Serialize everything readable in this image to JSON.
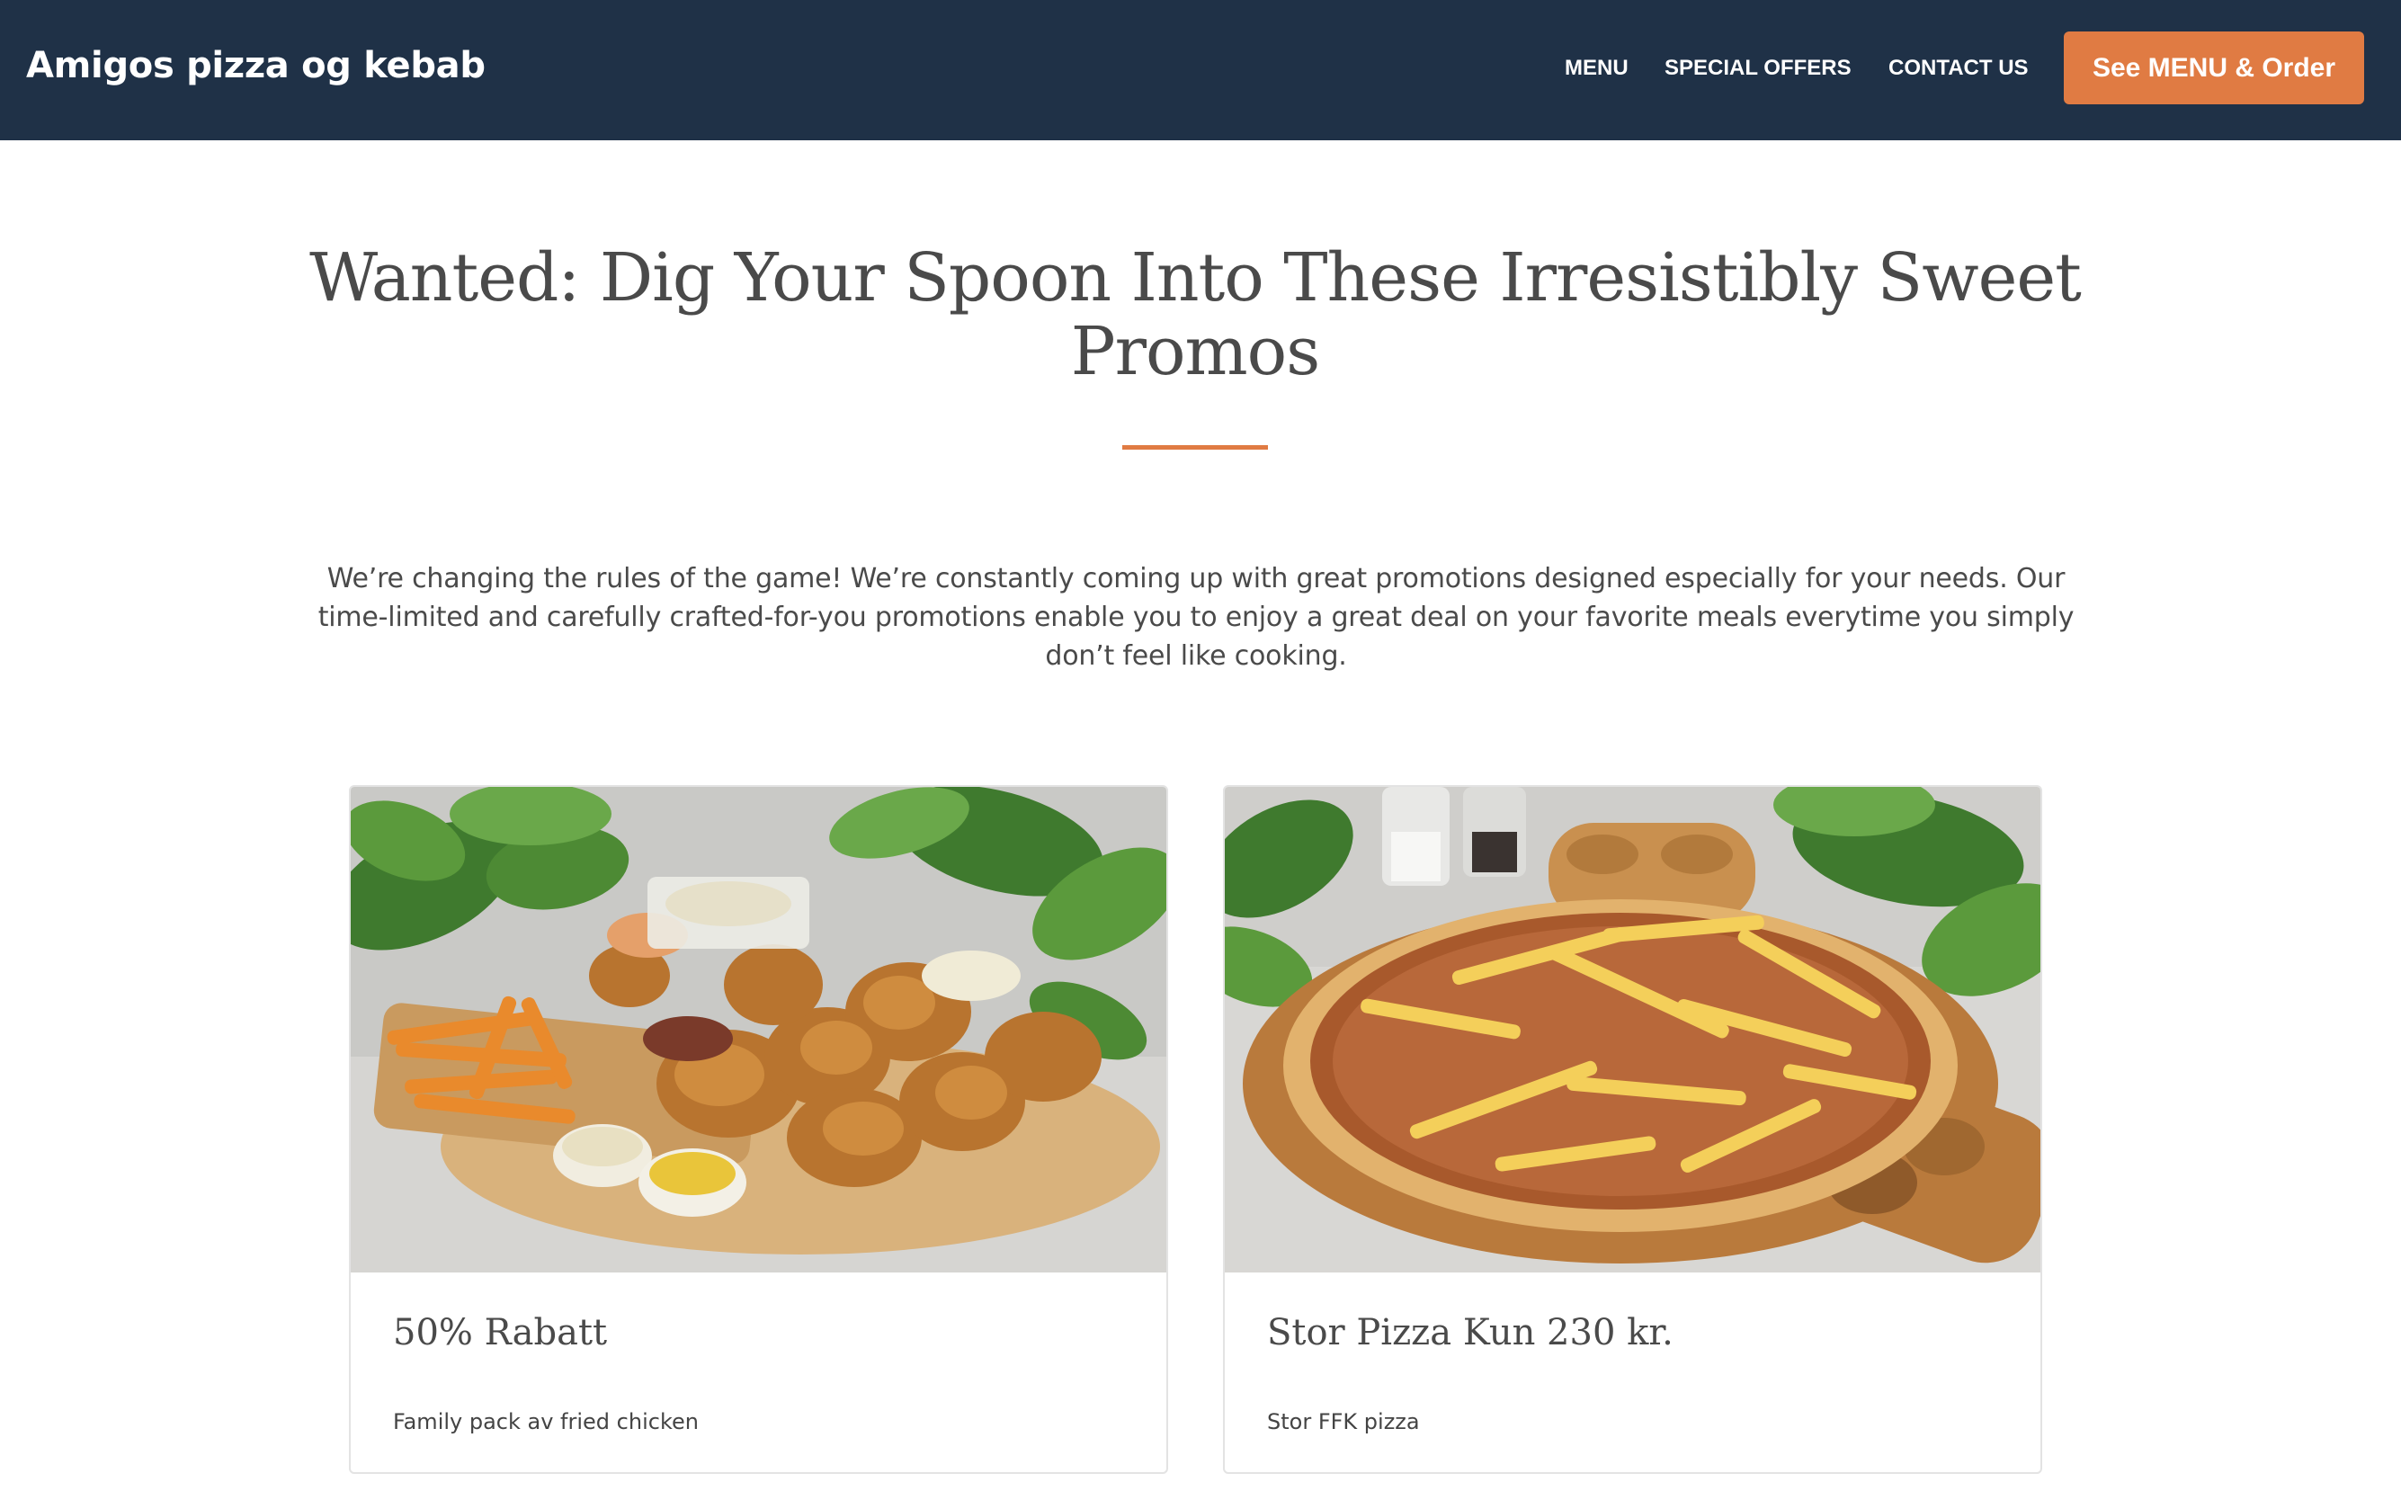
{
  "header": {
    "brand": "Amigos pizza og kebab",
    "nav": [
      {
        "label": "MENU"
      },
      {
        "label": "SPECIAL OFFERS"
      },
      {
        "label": "CONTACT US"
      }
    ],
    "cta_label": "See MENU & Order"
  },
  "colors": {
    "header_bg": "#1f3147",
    "accent": "#e07b43",
    "text": "#4a4a4a"
  },
  "hero": {
    "title": "Wanted: Dig Your Spoon Into These Irresistibly Sweet Promos",
    "intro": "We’re changing the rules of the game! We’re constantly coming up with great promotions designed especially for your needs. Our time-limited and carefully crafted-for-you promotions enable you to enjoy a great deal on your favorite meals everytime you simply don’t feel like cooking."
  },
  "offers": [
    {
      "image": "fried-chicken-platter-photo",
      "title": "50% Rabatt",
      "description": "Family pack av fried chicken"
    },
    {
      "image": "pizza-with-fries-photo",
      "title": "Stor Pizza Kun 230 kr.",
      "description": "Stor FFK pizza"
    }
  ]
}
